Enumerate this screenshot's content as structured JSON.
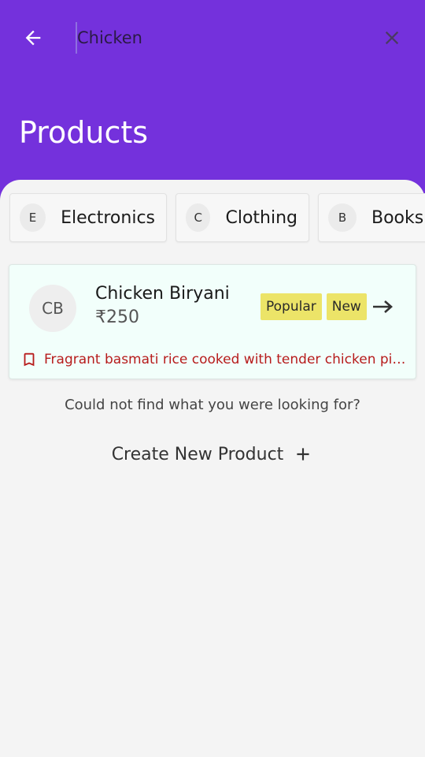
{
  "header": {
    "search": {
      "value": "Chicken",
      "placeholder": ""
    },
    "title": "Products",
    "color": "#7431dc"
  },
  "categories": [
    {
      "initial": "E",
      "label": "Electronics"
    },
    {
      "initial": "C",
      "label": "Clothing"
    },
    {
      "initial": "B",
      "label": "Books"
    }
  ],
  "results": [
    {
      "initials": "CB",
      "name": "Chicken Biryani",
      "price": "₹250",
      "tags": [
        "Popular",
        "New"
      ],
      "description": "Fragrant basmati rice cooked with tender chicken pieces",
      "tag_color": "#ece468",
      "description_color": "#b71c1c"
    }
  ],
  "footer": {
    "not_found_text": "Could not find what you were looking for?",
    "create_label": "Create New Product"
  },
  "icons": {
    "back": "arrow-left",
    "clear": "close",
    "open": "arrow-right",
    "bookmark": "bookmark-outline",
    "add": "plus"
  }
}
